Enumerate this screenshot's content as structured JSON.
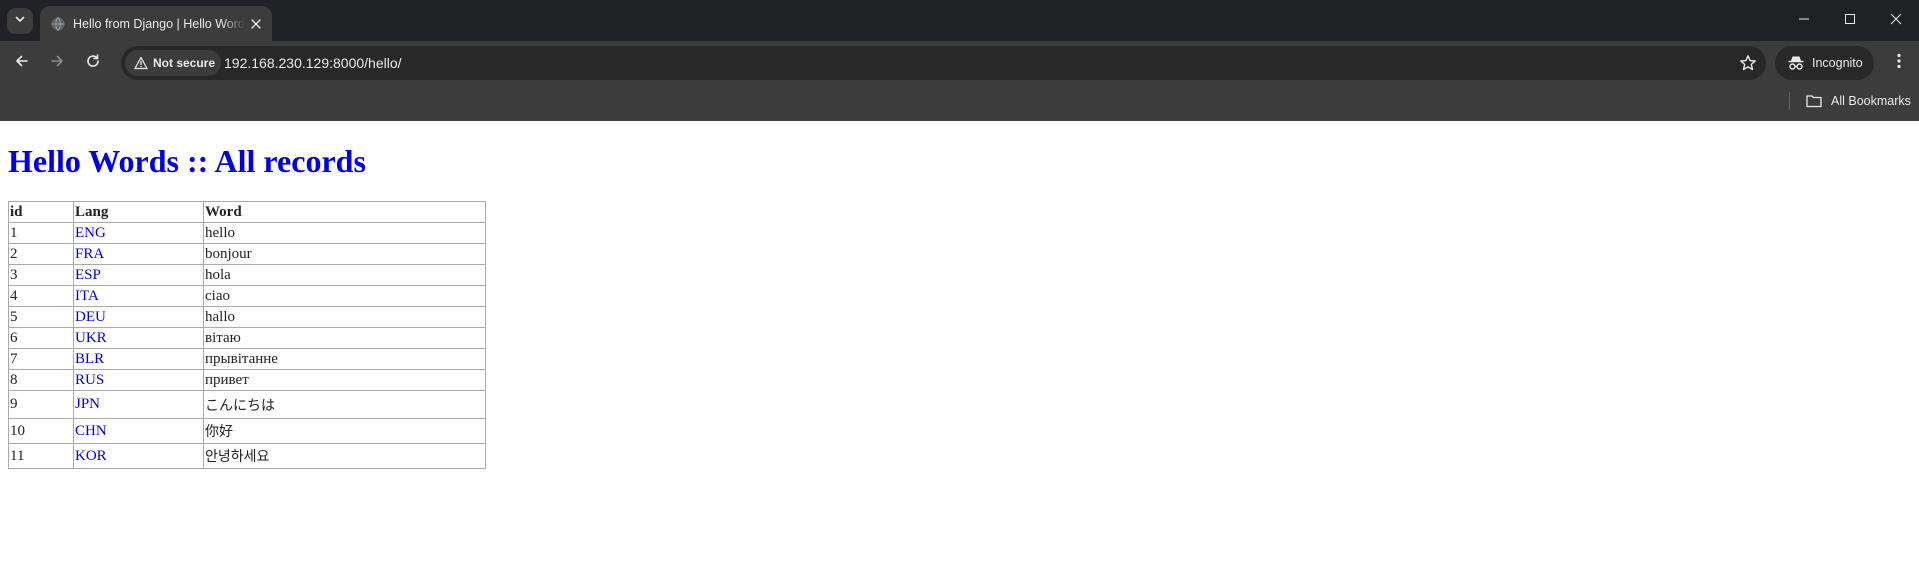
{
  "browser": {
    "tab_title": "Hello from Django | Hello Words",
    "security_label": "Not secure",
    "url": "192.168.230.129:8000/hello/",
    "incognito_label": "Incognito",
    "bookmarks_label": "All Bookmarks"
  },
  "page": {
    "heading": "Hello Words :: All records",
    "table": {
      "headers": [
        "id",
        "Lang",
        "Word"
      ],
      "rows": [
        {
          "id": "1",
          "lang": "ENG",
          "word": "hello"
        },
        {
          "id": "2",
          "lang": "FRA",
          "word": "bonjour"
        },
        {
          "id": "3",
          "lang": "ESP",
          "word": "hola"
        },
        {
          "id": "4",
          "lang": "ITA",
          "word": "ciao"
        },
        {
          "id": "5",
          "lang": "DEU",
          "word": "hallo"
        },
        {
          "id": "6",
          "lang": "UKR",
          "word": "вітаю"
        },
        {
          "id": "7",
          "lang": "BLR",
          "word": "прывітанне"
        },
        {
          "id": "8",
          "lang": "RUS",
          "word": "привет"
        },
        {
          "id": "9",
          "lang": "JPN",
          "word": "こんにちは"
        },
        {
          "id": "10",
          "lang": "CHN",
          "word": "你好"
        },
        {
          "id": "11",
          "lang": "KOR",
          "word": "안녕하세요"
        }
      ]
    }
  },
  "colors": {
    "link": "#0000ee",
    "chrome_dark": "#202124",
    "chrome_toolbar": "#3c3c3c",
    "omnibox": "#282828"
  }
}
